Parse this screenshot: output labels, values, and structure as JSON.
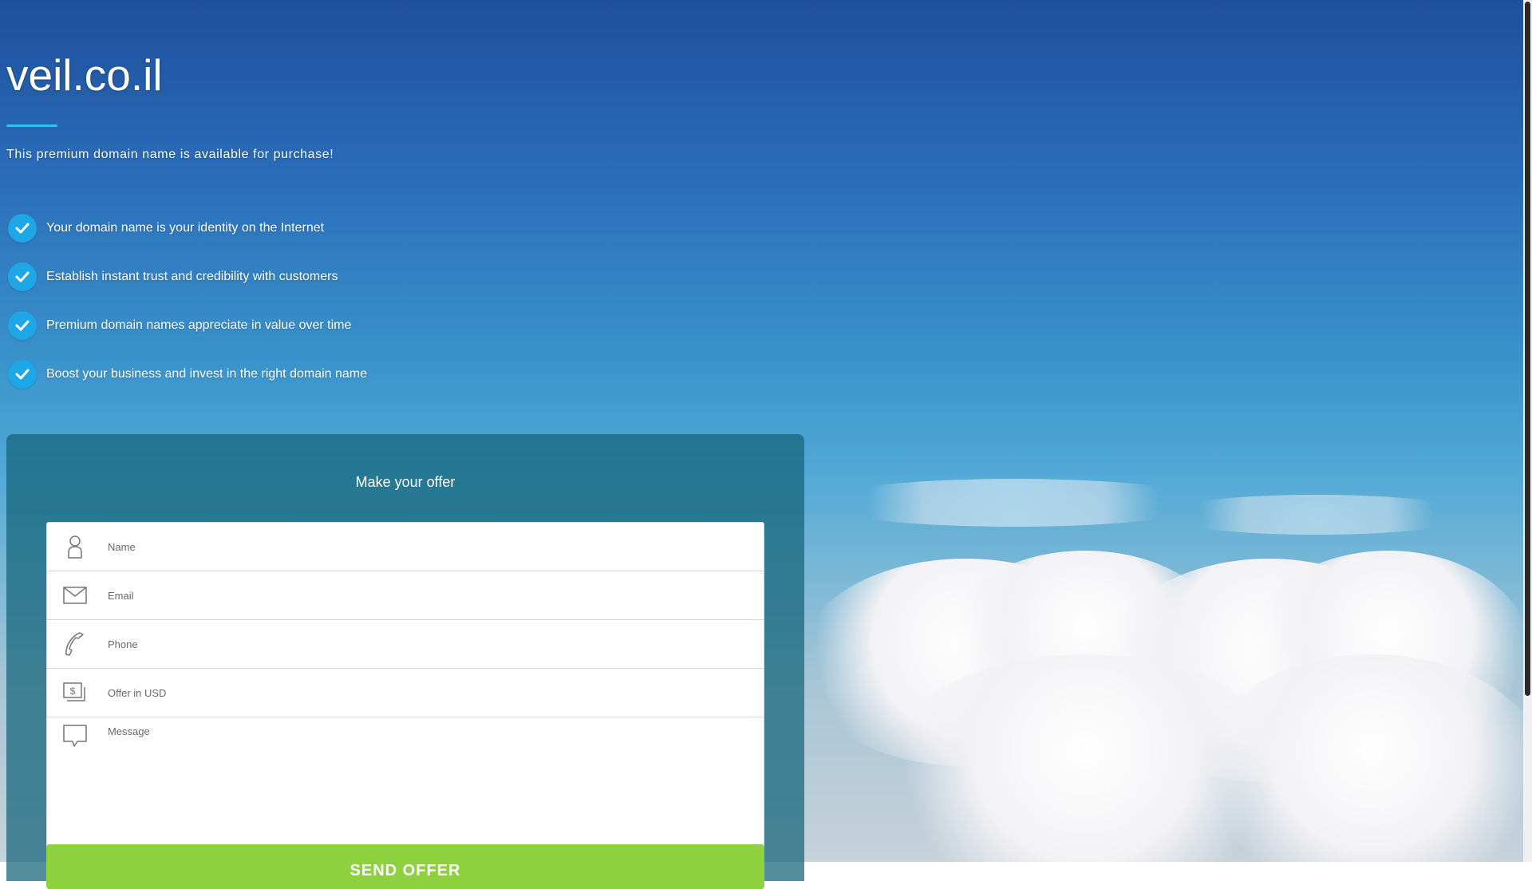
{
  "site": {
    "domain": "veil.co.il",
    "subtitle": "This premium domain name is available for purchase!"
  },
  "features": [
    "Your domain name is your identity on the Internet",
    "Establish instant trust and credibility with customers",
    "Premium domain names appreciate in value over time",
    "Boost your business and invest in the right domain name"
  ],
  "offer_form": {
    "title": "Make your offer",
    "name_placeholder": "Name",
    "email_placeholder": "Email",
    "phone_placeholder": "Phone",
    "offer_placeholder": "Offer in USD",
    "message_placeholder": "Message",
    "submit_label": "SEND OFFER"
  },
  "icons": {
    "check": "check-icon",
    "name": "user-icon",
    "email": "envelope-icon",
    "phone": "phone-icon",
    "offer": "money-icon",
    "message": "speech-bubble-icon"
  },
  "colors": {
    "accent": "#29c3f0",
    "check_bg": "#1ea7e6",
    "button": "#8dd13f",
    "panel": "#14647a"
  }
}
